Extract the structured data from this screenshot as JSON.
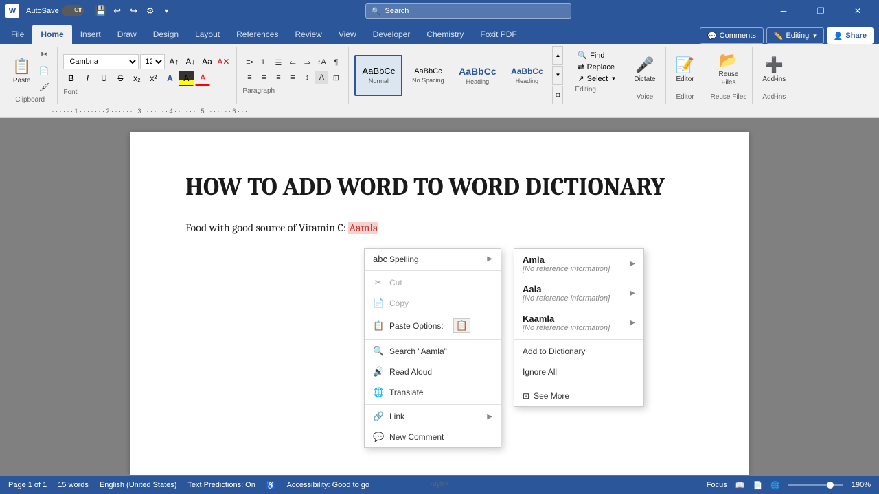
{
  "titlebar": {
    "app_icon": "W",
    "autosave_label": "AutoSave",
    "autosave_state": "Off",
    "search_placeholder": "Search",
    "undo_tooltip": "Undo",
    "redo_tooltip": "Redo",
    "minimize_label": "─",
    "restore_label": "❐",
    "close_label": "✕"
  },
  "quickaccess": {
    "save": "💾",
    "undo": "↩",
    "redo": "↪",
    "more": "▾"
  },
  "ribbontabs": {
    "tabs": [
      "File",
      "Home",
      "Insert",
      "Draw",
      "Design",
      "Layout",
      "References",
      "Review",
      "View",
      "Developer",
      "Chemistry",
      "Foxit PDF"
    ],
    "active": "Home",
    "comments_label": "Comments",
    "editing_label": "Editing",
    "share_label": "Share"
  },
  "ribbon": {
    "clipboard_label": "Clipboard",
    "font_label": "Font",
    "paragraph_label": "Paragraph",
    "styles_label": "Styles",
    "editing_label": "Editing",
    "voice_label": "Voice",
    "editor_label": "Editor",
    "reuse_label": "Reuse Files",
    "addins_label": "Add-ins",
    "paste_label": "Paste",
    "font_face": "Cambria",
    "font_size": "12",
    "style_normal": "Normal",
    "style_nospace": "No Spacing",
    "style_h1": "Heading 1",
    "style_h1_short": "Heading",
    "style_h2": "Heading 2",
    "style_h2_short": "Heading",
    "find_label": "Find",
    "replace_label": "Replace",
    "select_label": "Select",
    "dictate_label": "Dictate",
    "editor_btn_label": "Editor",
    "reuse_files_label": "Reuse\nFiles",
    "addins_btn_label": "Add-ins"
  },
  "document": {
    "title": "HOW TO ADD WORD TO WORD DICTIONARY",
    "body_text": "Food with good source of Vitamin C: Aamla",
    "body_prefix": "Food with good source of Vitamin C: ",
    "highlighted_word": "Aamla"
  },
  "contextmenu": {
    "spelling_label": "Spelling",
    "cut_label": "Cut",
    "copy_label": "Copy",
    "paste_options_label": "Paste Options:",
    "search_label": "Search \"Aamla\"",
    "read_aloud_label": "Read Aloud",
    "translate_label": "Translate",
    "link_label": "Link",
    "new_comment_label": "New Comment"
  },
  "spellmenu": {
    "items": [
      {
        "word": "Amla",
        "ref": "[No reference information]",
        "has_arrow": true
      },
      {
        "word": "Aala",
        "ref": "[No reference information]",
        "has_arrow": true
      },
      {
        "word": "Kaamla",
        "ref": "[No reference information]",
        "has_arrow": true
      }
    ],
    "add_to_dict": "Add to Dictionary",
    "ignore_all": "Ignore All",
    "see_more": "See More"
  },
  "statusbar": {
    "page_info": "Page 1 of 1",
    "words": "15 words",
    "language": "English (United States)",
    "text_predictions": "Text Predictions: On",
    "accessibility": "Accessibility: Good to go",
    "focus_label": "Focus",
    "zoom_level": "190%"
  }
}
